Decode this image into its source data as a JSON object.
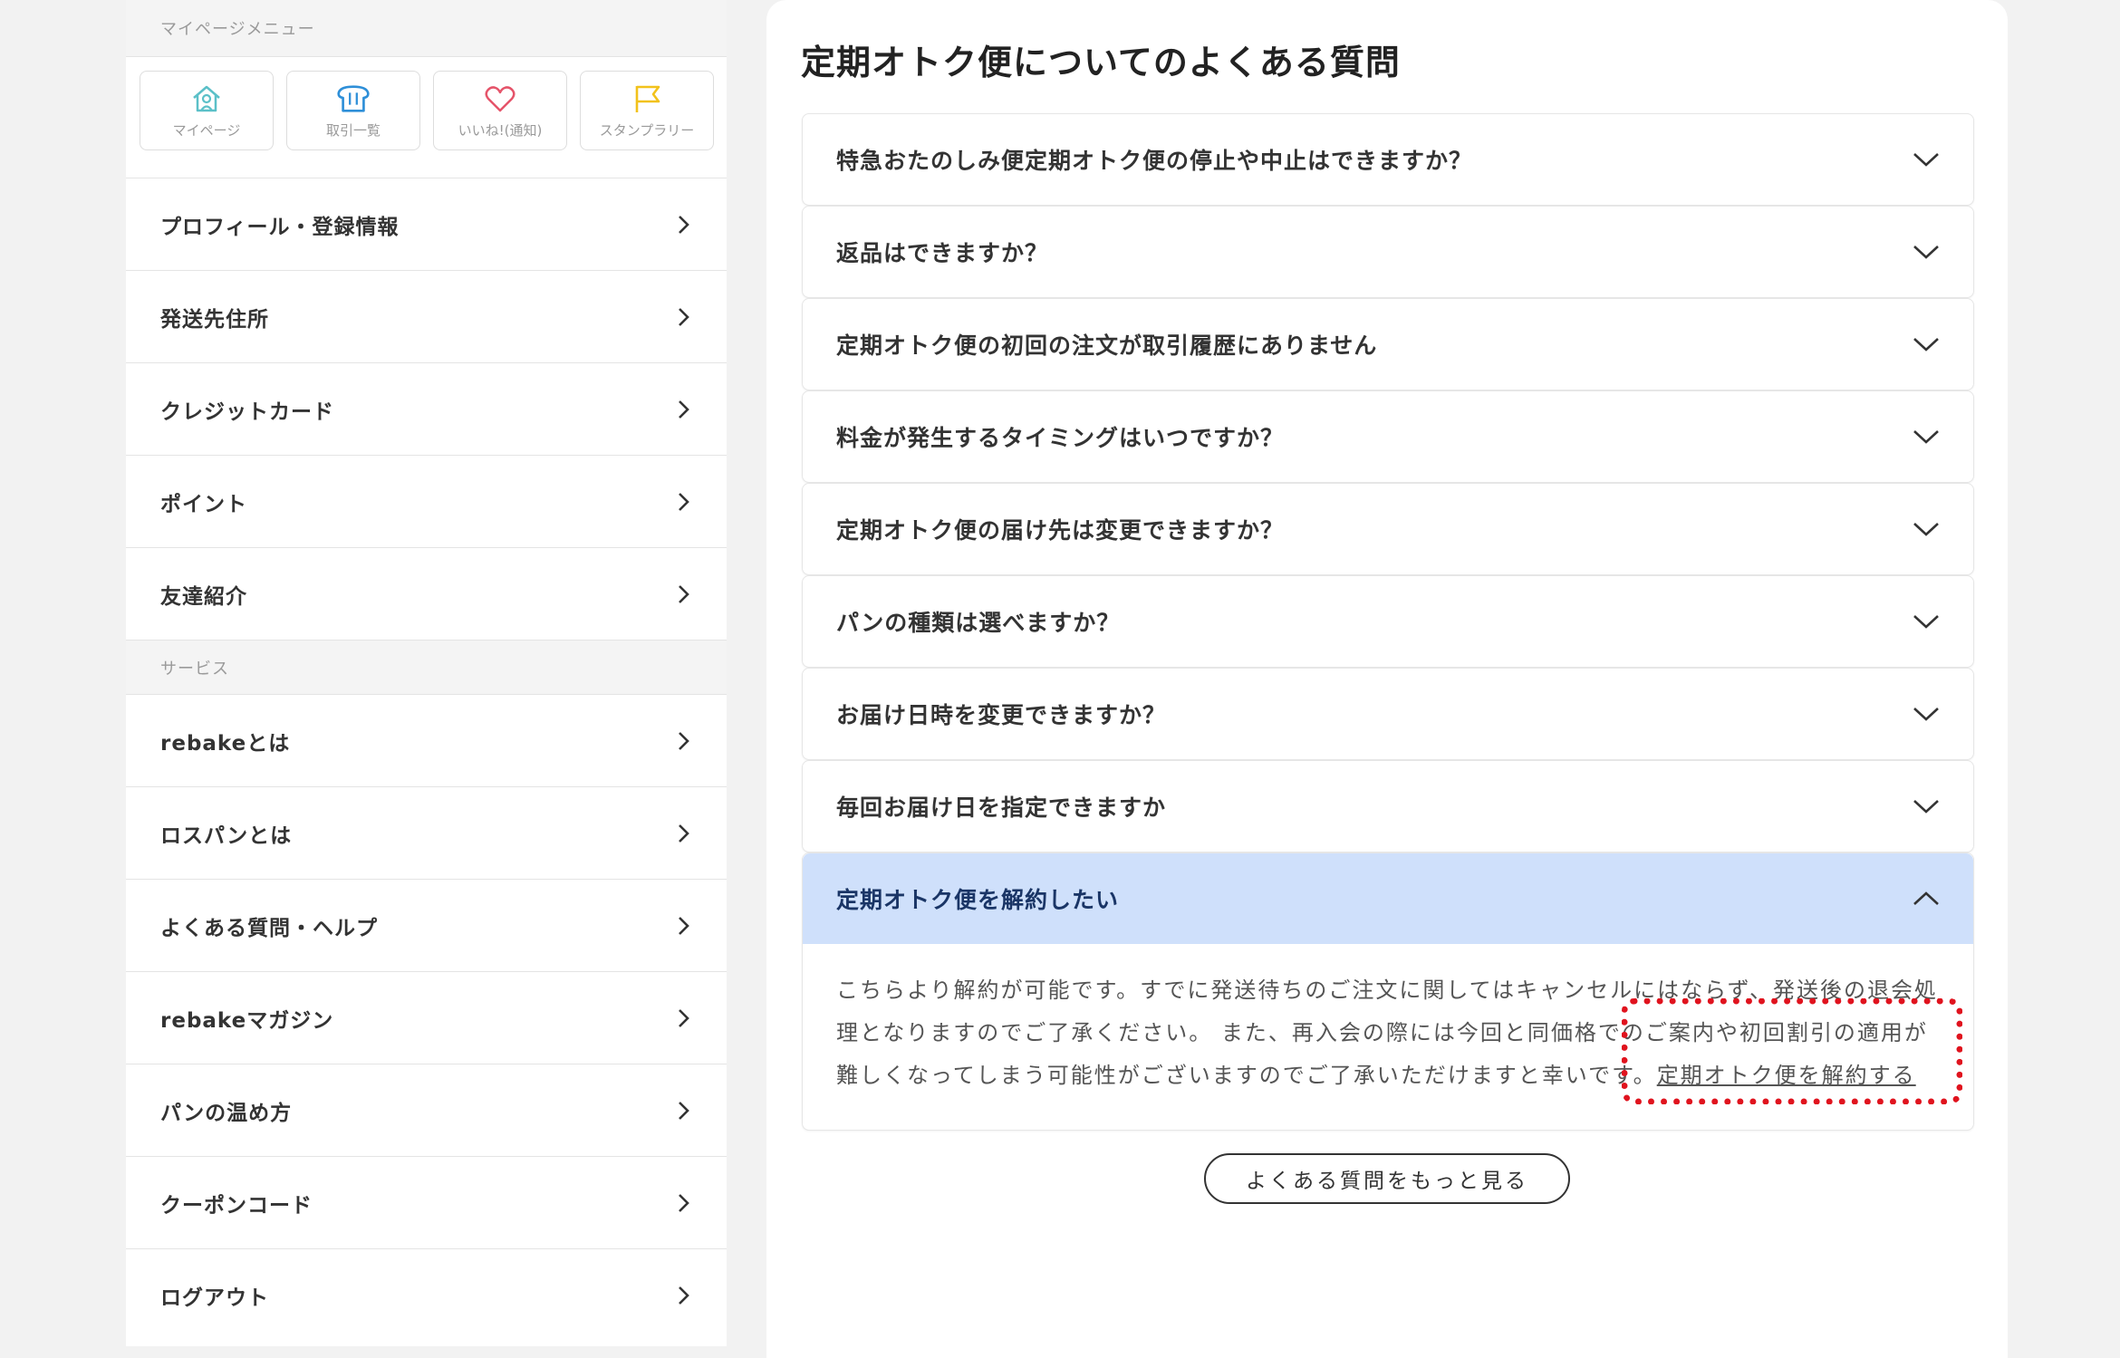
{
  "sidebar": {
    "mypage_header": "マイページメニュー",
    "tiles": [
      {
        "label": "マイページ",
        "icon": "home-icon",
        "color": "#5bc0c8"
      },
      {
        "label": "取引一覧",
        "icon": "bread-icon",
        "color": "#2e8fd8"
      },
      {
        "label": "いいね!(通知)",
        "icon": "heart-icon",
        "color": "#e5546a"
      },
      {
        "label": "スタンプラリー",
        "icon": "flag-icon",
        "color": "#f2c21b"
      }
    ],
    "account_items": [
      {
        "label": "プロフィール・登録情報"
      },
      {
        "label": "発送先住所"
      },
      {
        "label": "クレジットカード"
      },
      {
        "label": "ポイント"
      },
      {
        "label": "友達紹介"
      }
    ],
    "service_header": "サービス",
    "service_items": [
      {
        "label": "rebakeとは"
      },
      {
        "label": "ロスパンとは"
      },
      {
        "label": "よくある質問・ヘルプ"
      },
      {
        "label": "rebakeマガジン"
      },
      {
        "label": "パンの温め方"
      },
      {
        "label": "クーポンコード"
      },
      {
        "label": "ログアウト"
      }
    ]
  },
  "main": {
    "title": "定期オトク便についてのよくある質問",
    "faqs": [
      {
        "question": "特急おたのしみ便定期オトク便の停止や中止はできますか？",
        "open": false
      },
      {
        "question": "返品はできますか？",
        "open": false
      },
      {
        "question": "定期オトク便の初回の注文が取引履歴にありません",
        "open": false
      },
      {
        "question": "料金が発生するタイミングはいつですか？",
        "open": false
      },
      {
        "question": "定期オトク便の届け先は変更できますか？",
        "open": false
      },
      {
        "question": "パンの種類は選べますか？",
        "open": false
      },
      {
        "question": "お届け日時を変更できますか？",
        "open": false
      },
      {
        "question": "毎回お届け日を指定できますか",
        "open": false
      },
      {
        "question": "定期オトク便を解約したい",
        "open": true
      }
    ],
    "open_answer": {
      "text": "こちらより解約が可能です。すでに発送待ちのご注文に関してはキャンセルにはならず、発送後の退会処理となりますのでご了承ください。 また、再入会の際には今回と同価格でのご案内や初回割引の適用が難しくなってしまう可能性がございますのでご了承いただけますと幸いです。",
      "link": "定期オトク便を解約する"
    },
    "more_button": "よくある質問をもっと見る"
  },
  "colors": {
    "open_header_bg": "#cfe0fb",
    "highlight": "#e0131e"
  }
}
